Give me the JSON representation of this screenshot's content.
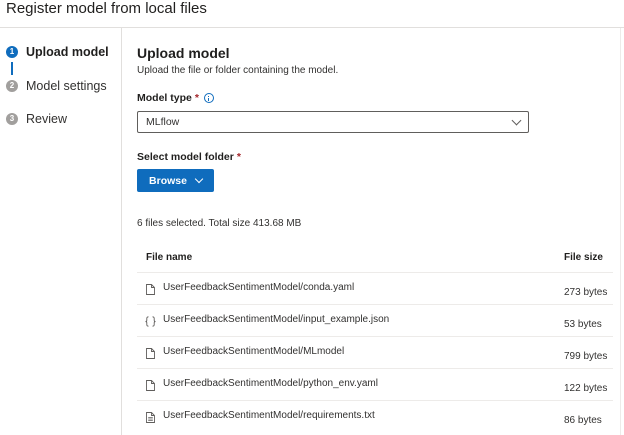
{
  "page": {
    "title": "Register model from local files"
  },
  "steps": [
    {
      "number": "1",
      "label": "Upload model",
      "active": true
    },
    {
      "number": "2",
      "label": "Model settings",
      "active": false
    },
    {
      "number": "3",
      "label": "Review",
      "active": false
    }
  ],
  "main": {
    "heading": "Upload model",
    "subtitle": "Upload the file or folder containing the model.",
    "model_type": {
      "label": "Model type",
      "required_mark": "*",
      "value": "MLflow"
    },
    "model_folder": {
      "label": "Select model folder",
      "required_mark": "*",
      "browse_label": "Browse"
    },
    "summary": "6 files selected. Total size 413.68 MB"
  },
  "table": {
    "columns": [
      "File name",
      "File size"
    ],
    "rows": [
      {
        "icon": "file-icon",
        "name": "UserFeedbackSentimentModel/conda.yaml",
        "size": "273 bytes"
      },
      {
        "icon": "json-icon",
        "name": "UserFeedbackSentimentModel/input_example.json",
        "size": "53 bytes"
      },
      {
        "icon": "file-icon",
        "name": "UserFeedbackSentimentModel/MLmodel",
        "size": "799 bytes"
      },
      {
        "icon": "file-icon",
        "name": "UserFeedbackSentimentModel/python_env.yaml",
        "size": "122 bytes"
      },
      {
        "icon": "text-file-icon",
        "name": "UserFeedbackSentimentModel/requirements.txt",
        "size": "86 bytes"
      }
    ]
  },
  "colors": {
    "accent": "#0f6cbd",
    "required": "#a4262c",
    "divider": "#e1dfdd"
  }
}
